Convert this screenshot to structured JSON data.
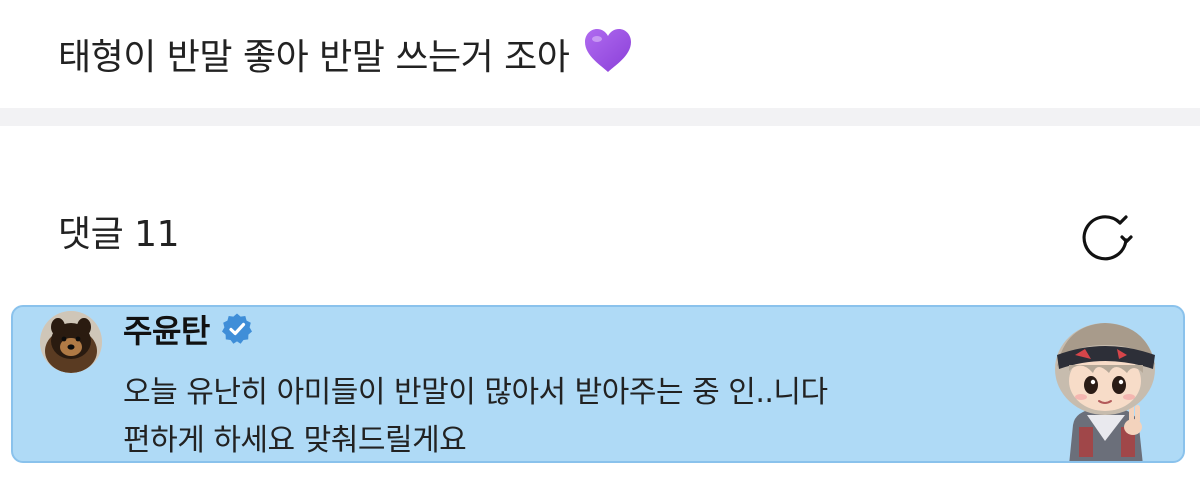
{
  "post": {
    "text": "태형이 반말 좋아 반말 쓰는거 조아",
    "emoji_icon": "purple-heart-icon",
    "emoji_color": "#9b4fe0"
  },
  "comments": {
    "title": "댓글 11",
    "refresh_icon": "refresh-icon"
  },
  "comment": {
    "author": "주윤탄",
    "verified_icon": "verified-badge-icon",
    "verified_color": "#3f8ed8",
    "lines": [
      "오늘 유난히 아미들이 반말이 많아서 받아주는 중 인..니다",
      "편하게 하세요 맞춰드릴게요"
    ],
    "highlight_color": "#afdaf6",
    "avatar_icon": "profile-avatar-icon",
    "sticker_icon": "character-sticker-icon"
  }
}
